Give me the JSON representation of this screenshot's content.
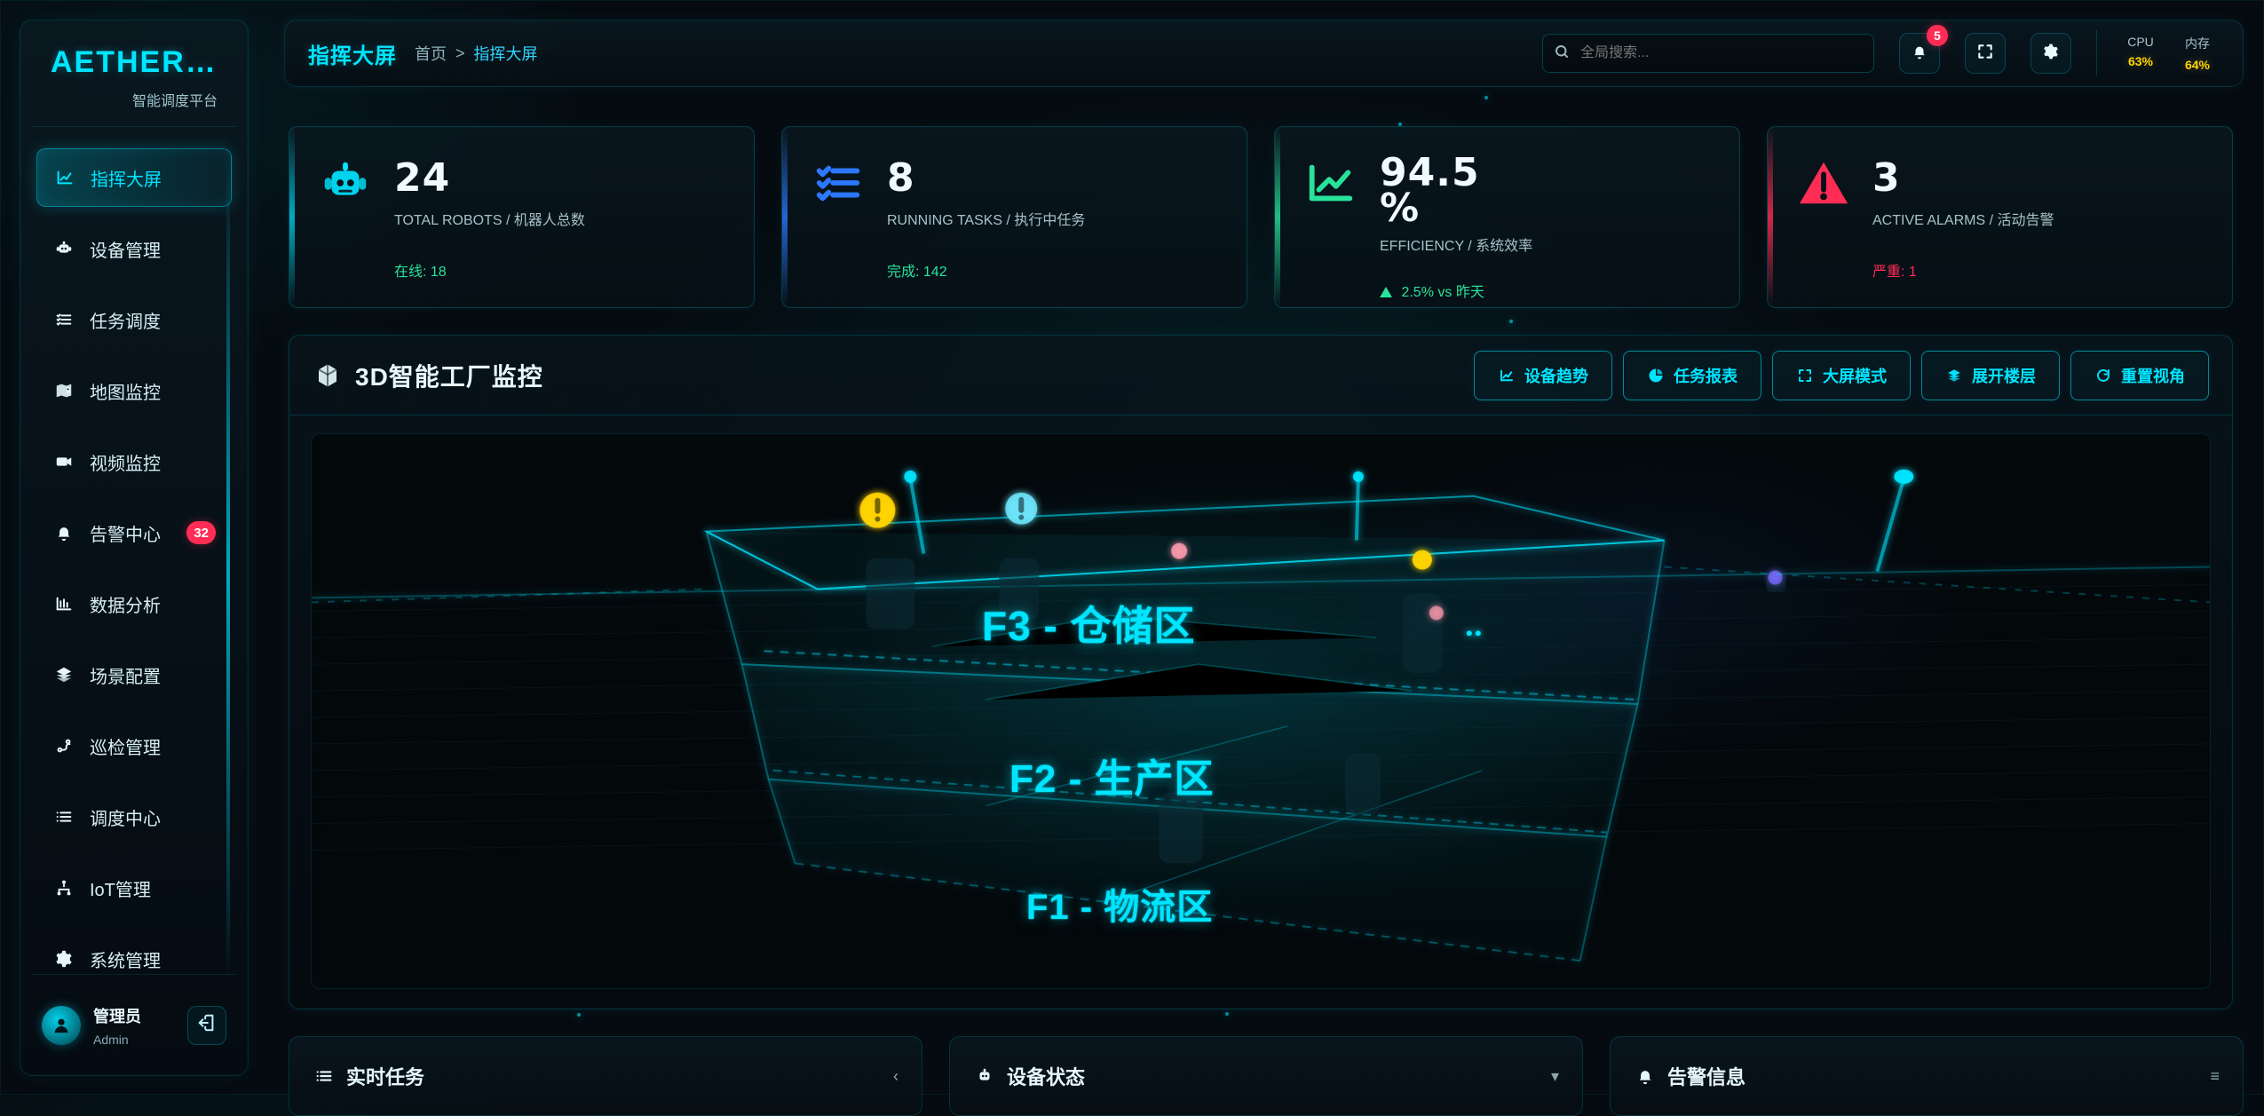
{
  "app": {
    "brand_title": "AETHERLI...",
    "brand_subtitle": "智能调度平台"
  },
  "sidebar": {
    "items": [
      {
        "label": "指挥大屏",
        "icon": "chart-line-icon",
        "active": true
      },
      {
        "label": "设备管理",
        "icon": "robot-icon"
      },
      {
        "label": "任务调度",
        "icon": "list-check-icon"
      },
      {
        "label": "地图监控",
        "icon": "map-marker-icon"
      },
      {
        "label": "视频监控",
        "icon": "video-icon"
      },
      {
        "label": "告警中心",
        "icon": "bell-icon",
        "badge": "32"
      },
      {
        "label": "数据分析",
        "icon": "bar-chart-icon"
      },
      {
        "label": "场景配置",
        "icon": "layers-icon"
      },
      {
        "label": "巡检管理",
        "icon": "route-icon"
      },
      {
        "label": "调度中心",
        "icon": "list-icon"
      },
      {
        "label": "IoT管理",
        "icon": "network-icon"
      },
      {
        "label": "系统管理",
        "icon": "gear-icon"
      }
    ],
    "user": {
      "name": "管理员",
      "role": "Admin"
    }
  },
  "topbar": {
    "title": "指挥大屏",
    "breadcrumb": {
      "home": "首页",
      "sep": ">",
      "current": "指挥大屏"
    },
    "search": {
      "placeholder": "全局搜索..."
    },
    "notifications": {
      "count": "5"
    },
    "metrics": {
      "cpu": {
        "label": "CPU",
        "value": "63%"
      },
      "mem": {
        "label": "内存",
        "value": "64%"
      }
    }
  },
  "stats": [
    {
      "value": "24",
      "title": "TOTAL ROBOTS / 机器人总数",
      "sub": "在线: 18",
      "icon": "robot-icon",
      "accent": "#00e5ff"
    },
    {
      "value": "8",
      "title": "RUNNING TASKS / 执行中任务",
      "sub": "完成: 142",
      "icon": "task-list-icon",
      "accent": "#2b78ff"
    },
    {
      "value_line1": "94.5",
      "value_line2": "%",
      "title": "EFFICIENCY / 系统效率",
      "sub": "2.5% vs 昨天",
      "icon": "trend-up-icon",
      "accent": "#29e29a"
    },
    {
      "value": "3",
      "title": "ACTIVE ALARMS / 活动告警",
      "sub": "严重: 1",
      "icon": "warning-triangle-icon",
      "accent": "#ff2d55"
    }
  ],
  "factory": {
    "title": "3D智能工厂监控",
    "actions": [
      {
        "label": "设备趋势",
        "icon": "chart-line-icon"
      },
      {
        "label": "任务报表",
        "icon": "pie-chart-icon"
      },
      {
        "label": "大屏模式",
        "icon": "fullscreen-icon"
      },
      {
        "label": "展开楼层",
        "icon": "layers-icon"
      },
      {
        "label": "重置视角",
        "icon": "refresh-icon"
      }
    ],
    "floors": [
      {
        "label": "F3 - 仓储区"
      },
      {
        "label": "F2 - 生产区"
      },
      {
        "label": "F1 - 物流区"
      }
    ]
  },
  "bottom_panels": [
    {
      "title": "实时任务",
      "icon": "list-icon",
      "hint": "‹"
    },
    {
      "title": "设备状态",
      "icon": "robot-icon",
      "hint": "▾"
    },
    {
      "title": "告警信息",
      "icon": "bell-icon",
      "hint": "≡"
    }
  ],
  "colors": {
    "accent": "#00e5ff",
    "danger": "#ff2d55",
    "success": "#29e29a",
    "warning": "#ffd400"
  }
}
